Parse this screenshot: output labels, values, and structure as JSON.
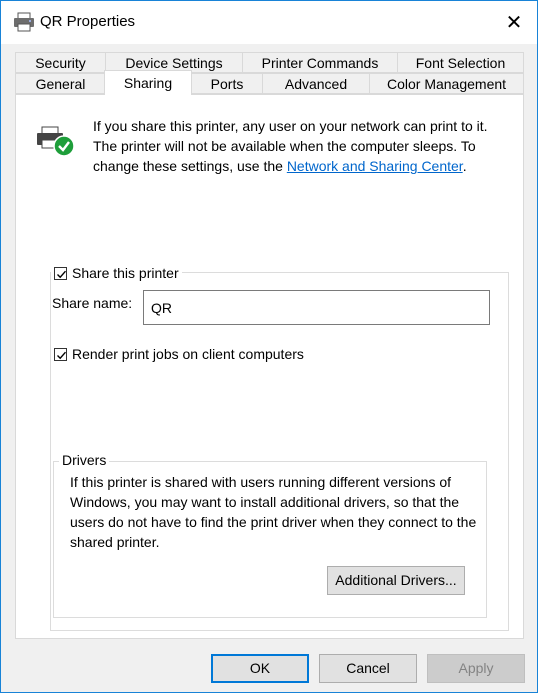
{
  "window": {
    "title": "QR Properties",
    "close_glyph": "✕"
  },
  "tabs_row1": [
    {
      "label": "Security"
    },
    {
      "label": "Device Settings"
    },
    {
      "label": "Printer Commands"
    },
    {
      "label": "Font Selection"
    }
  ],
  "tabs_row2": [
    {
      "label": "General"
    },
    {
      "label": "Sharing",
      "active": true
    },
    {
      "label": "Ports"
    },
    {
      "label": "Advanced"
    },
    {
      "label": "Color Management"
    }
  ],
  "info": {
    "text": "If you share this printer, any user on your network can print to it. The printer will not be available when the computer sleeps. To change these settings, use the ",
    "link": "Network and Sharing Center",
    "link_suffix": "."
  },
  "share": {
    "checkbox_label": "Share this printer",
    "checked": true,
    "name_label": "Share name:",
    "name_value": "QR",
    "render_label": "Render print jobs on client computers",
    "render_checked": true
  },
  "drivers": {
    "legend": "Drivers",
    "text": "If this printer is shared with users running different versions of Windows, you may want to install additional drivers, so that the users do not have to find the print driver when they connect to the shared printer.",
    "button": "Additional Drivers..."
  },
  "footer": {
    "ok": "OK",
    "cancel": "Cancel",
    "apply": "Apply"
  },
  "colors": {
    "accent": "#0078d7",
    "link": "#0066cc",
    "check_badge": "#1e9e3a"
  },
  "icons": {
    "title": "printer-icon",
    "info": "shared-printer-icon"
  }
}
